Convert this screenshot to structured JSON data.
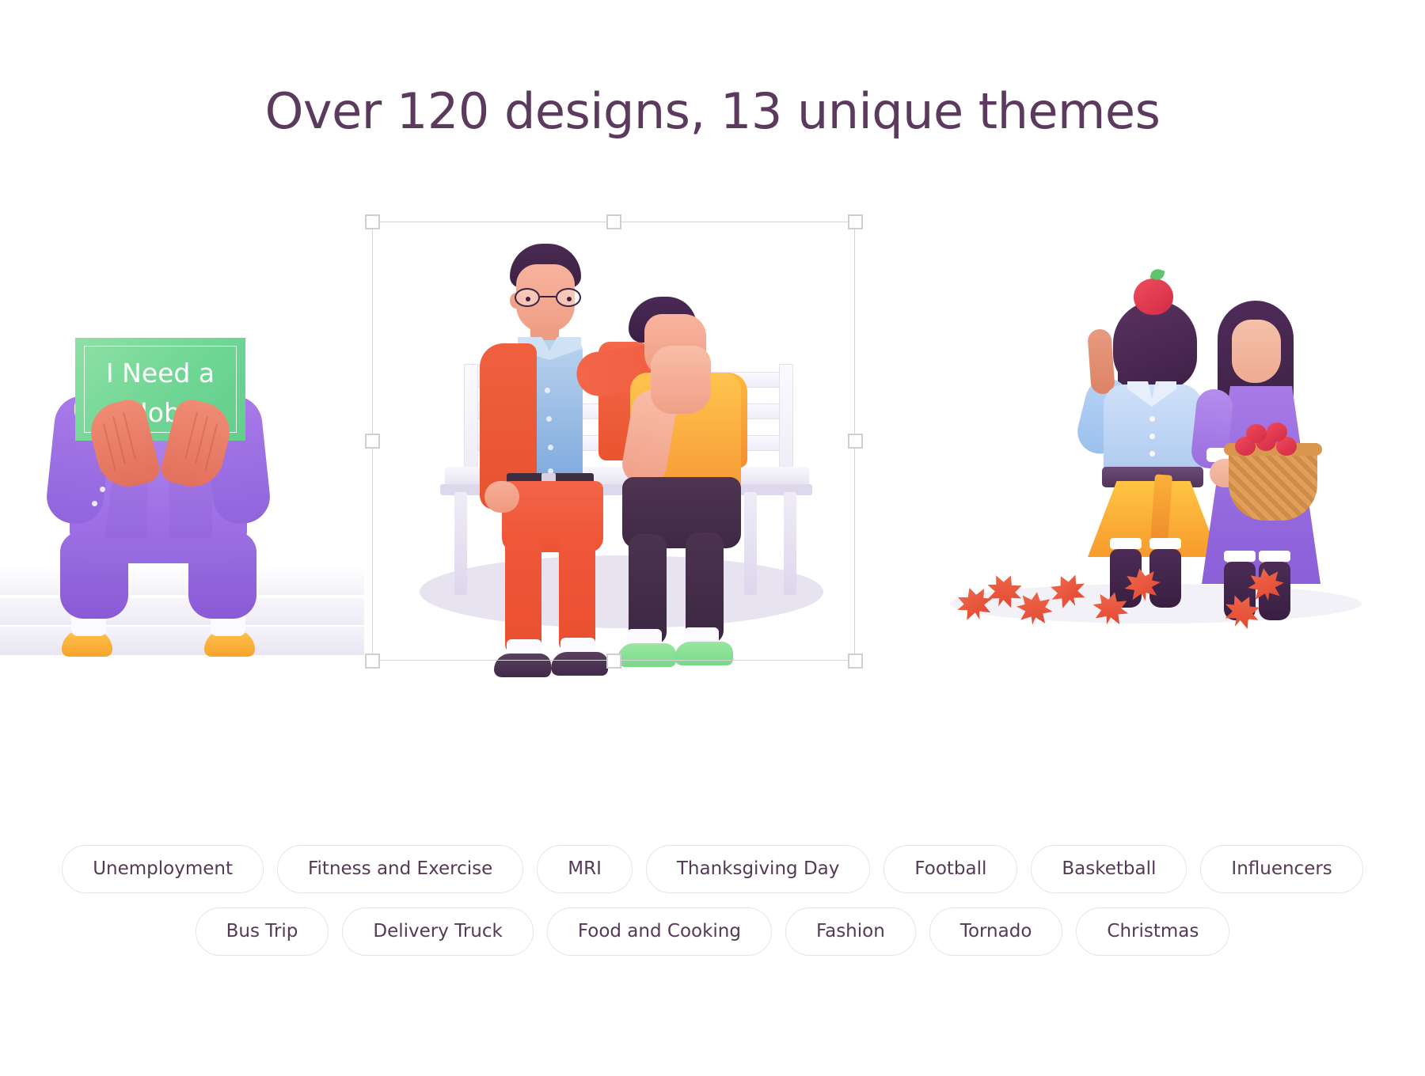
{
  "header": {
    "title": "Over 120 designs, 13 unique themes",
    "title_color": "#5b3a5e"
  },
  "illustrations": {
    "left": {
      "name": "unemployment-illustration",
      "sign_line1": "I Need a",
      "sign_line2": "Job",
      "sign_color": "#6fd694",
      "sign_text_color": "#ffffff"
    },
    "center": {
      "name": "comfort-on-bench-illustration",
      "selected": true,
      "selection_handles": [
        "top-left",
        "top-center",
        "top-right",
        "middle-left",
        "middle-right",
        "bottom-left",
        "bottom-center",
        "bottom-right"
      ],
      "selection_border_color": "#d5d5d8"
    },
    "right": {
      "name": "thanksgiving-apple-picking-illustration"
    }
  },
  "tags": {
    "row1": [
      {
        "label": "Unemployment"
      },
      {
        "label": "Fitness and Exercise"
      },
      {
        "label": "MRI"
      },
      {
        "label": "Thanksgiving Day"
      },
      {
        "label": "Football"
      },
      {
        "label": "Basketball"
      },
      {
        "label": "Influencers"
      }
    ],
    "row2": [
      {
        "label": "Bus Trip"
      },
      {
        "label": "Delivery Truck"
      },
      {
        "label": "Food and Cooking"
      },
      {
        "label": "Fashion"
      },
      {
        "label": "Tornado"
      },
      {
        "label": "Christmas"
      }
    ]
  },
  "colors": {
    "background": "#ffffff",
    "text_plum": "#553a55",
    "pill_border": "#e6e4ea",
    "accent_red": "#ef5c3d",
    "accent_purple": "#9a6ae2",
    "accent_yellow": "#ffc44d",
    "accent_green": "#6fd694"
  }
}
